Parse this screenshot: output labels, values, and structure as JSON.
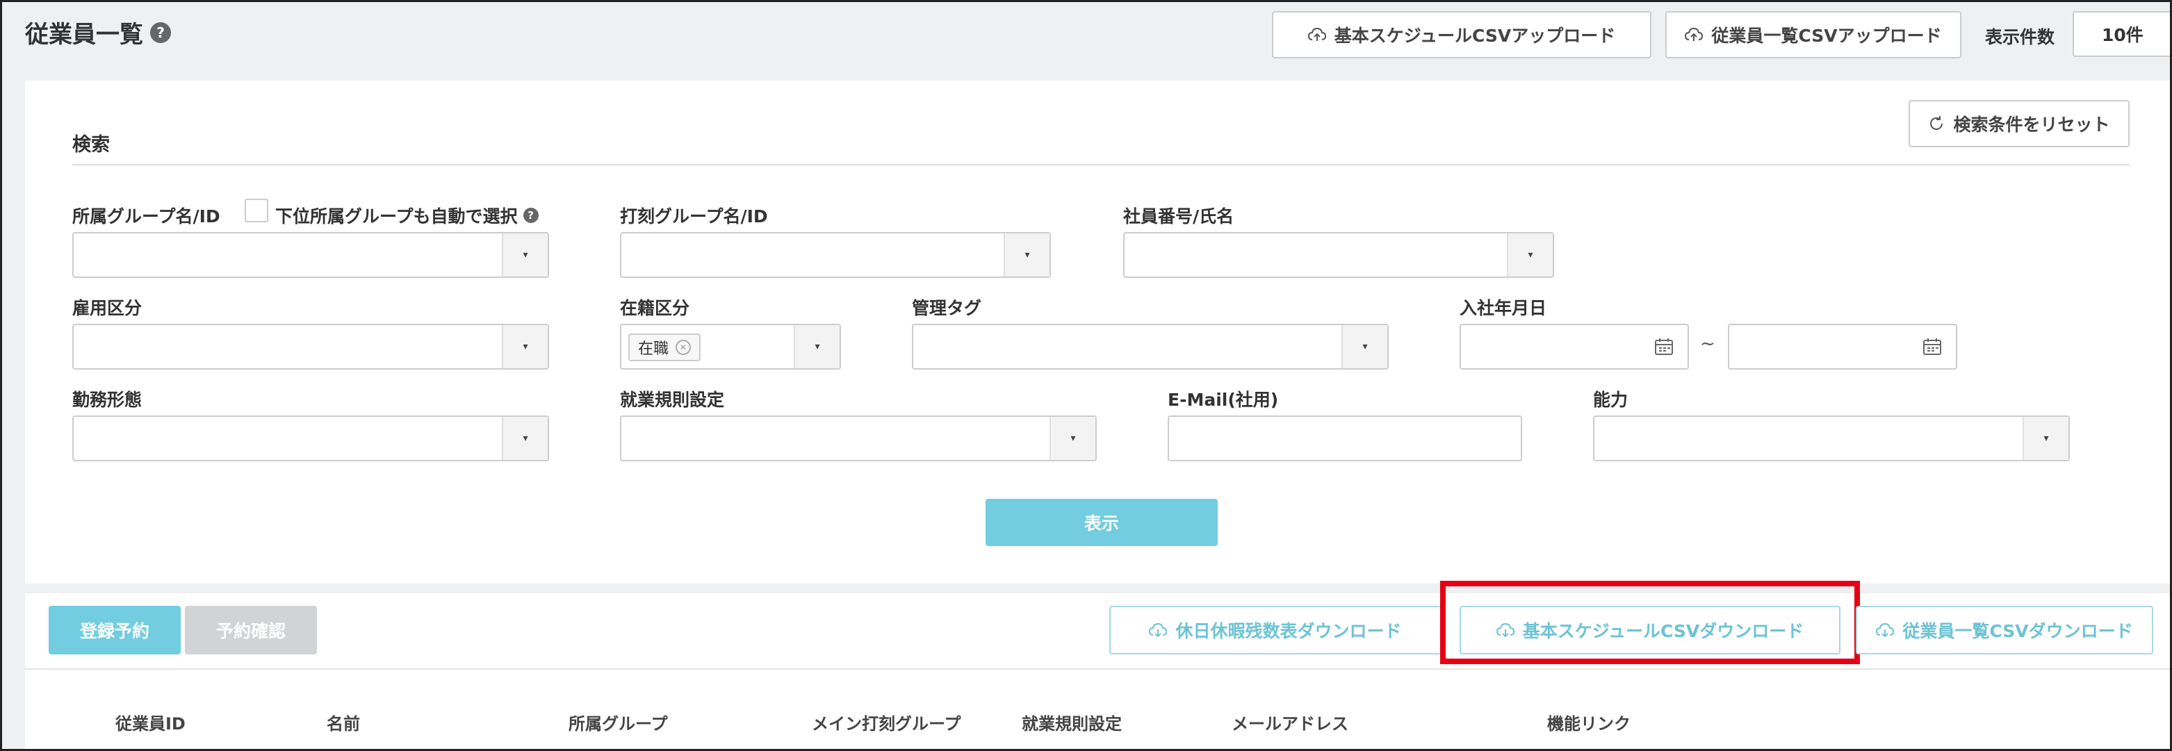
{
  "header": {
    "title": "従業員一覧",
    "help": "?",
    "upload_schedule_csv": "基本スケジュールCSVアップロード",
    "upload_employee_csv": "従業員一覧CSVアップロード",
    "page_size_label": "表示件数",
    "page_size_value": "10件"
  },
  "search": {
    "title": "検索",
    "reset_button": "検索条件をリセット",
    "group_label": "所属グループ名/ID",
    "subgroup_checkbox_label": "下位所属グループも自動で選択",
    "stamp_group_label": "打刻グループ名/ID",
    "employee_label": "社員番号/氏名",
    "employment_type_label": "雇用区分",
    "enrollment_label": "在籍区分",
    "enrollment_chip": "在職",
    "admin_tag_label": "管理タグ",
    "hire_date_label": "入社年月日",
    "hire_date_separator": "~",
    "work_style_label": "勤務形態",
    "rules_label": "就業規則設定",
    "email_label": "E-Mail(社用)",
    "ability_label": "能力",
    "show_button": "表示"
  },
  "actions": {
    "register_reservation": "登録予約",
    "check_reservation": "予約確認",
    "download_leave_balance": "休日休暇残数表ダウンロード",
    "download_schedule_csv": "基本スケジュールCSVダウンロード",
    "download_employee_csv": "従業員一覧CSVダウンロード"
  },
  "table": {
    "columns": [
      "従業員ID",
      "名前",
      "所属グループ",
      "メイン打刻グループ",
      "就業規則設定",
      "メールアドレス",
      "機能リンク"
    ]
  },
  "colors": {
    "accent": "#71cddf",
    "highlight": "#e60012"
  }
}
